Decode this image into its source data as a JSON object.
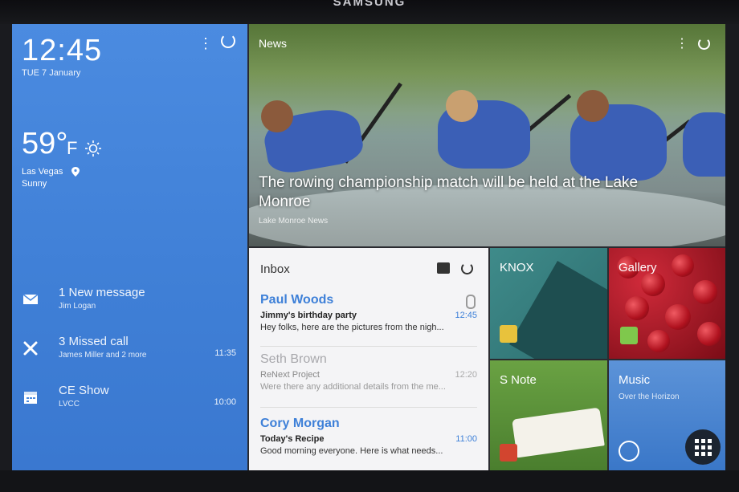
{
  "device": {
    "brand": "SAMSUNG"
  },
  "left_panel": {
    "time": "12:45",
    "date": "TUE 7 January",
    "weather": {
      "temp": "59°",
      "unit": "F",
      "city": "Las Vegas",
      "condition": "Sunny",
      "icon": "sun-icon"
    },
    "notifications": [
      {
        "title": "1 New message",
        "sub": "Jim Logan",
        "time": "",
        "icon": "envelope-icon"
      },
      {
        "title": "3 Missed call",
        "sub": "James Miller and 2 more",
        "time": "11:35",
        "icon": "missed-call-icon"
      },
      {
        "title": "CE Show",
        "sub": "LVCC",
        "time": "10:00",
        "icon": "calendar-icon"
      }
    ]
  },
  "news": {
    "label": "News",
    "headline": "The rowing championship match will be held at the Lake Monroe",
    "source": "Lake Monroe News"
  },
  "inbox": {
    "title": "Inbox",
    "messages": [
      {
        "from": "Paul Woods",
        "subject": "Jimmy's birthday party",
        "preview": "Hey folks, here are the pictures from the nigh...",
        "time": "12:45",
        "read": false
      },
      {
        "from": "Seth Brown",
        "subject": "ReNext Project",
        "preview": "Were there any additional details from the me...",
        "time": "12:20",
        "read": true
      },
      {
        "from": "Cory Morgan",
        "subject": "Today's Recipe",
        "preview": "Good morning everyone. Here is what needs...",
        "time": "11:00",
        "read": false
      }
    ]
  },
  "tiles": {
    "knox": "KNOX",
    "gallery": "Gallery",
    "snote": "S Note",
    "music": {
      "label": "Music",
      "sub": "Over the Horizon"
    }
  }
}
